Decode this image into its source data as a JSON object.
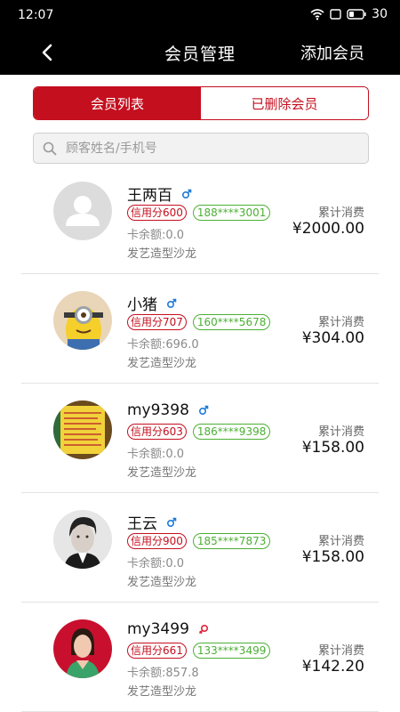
{
  "status": {
    "time": "12:07",
    "battery": "30"
  },
  "nav": {
    "title": "会员管理",
    "add_label": "添加会员"
  },
  "tabs": [
    {
      "label": "会员列表",
      "active": true
    },
    {
      "label": "已删除会员",
      "active": false
    }
  ],
  "search": {
    "placeholder": "顾客姓名/手机号"
  },
  "colors": {
    "accent": "#c40f1f",
    "phone_green": "#4caf33",
    "male_blue": "#1e7bd6",
    "female_red": "#e0223a"
  },
  "members": [
    {
      "name": "王两百",
      "gender": "male",
      "credit": "信用分600",
      "phone": "188****3001",
      "balance": "卡余额:0.0",
      "salon": "发艺造型沙龙",
      "consumption_label": "累计消费",
      "consumption": "¥2000.00",
      "avatar": "default-avatar"
    },
    {
      "name": "小猪",
      "gender": "male",
      "credit": "信用分707",
      "phone": "160****5678",
      "balance": "卡余额:696.0",
      "salon": "发艺造型沙龙",
      "consumption_label": "累计消费",
      "consumption": "¥304.00",
      "avatar": "minion-avatar"
    },
    {
      "name": "my9398",
      "gender": "male",
      "credit": "信用分603",
      "phone": "186****9398",
      "balance": "卡余额:0.0",
      "salon": "发艺造型沙龙",
      "consumption_label": "累计消费",
      "consumption": "¥158.00",
      "avatar": "menu-board-avatar"
    },
    {
      "name": "王云",
      "gender": "male",
      "credit": "信用分900",
      "phone": "185****7873",
      "balance": "卡余额:0.0",
      "salon": "发艺造型沙龙",
      "consumption_label": "累计消费",
      "consumption": "¥158.00",
      "avatar": "man-portrait-avatar"
    },
    {
      "name": "my3499",
      "gender": "female",
      "credit": "信用分661",
      "phone": "133****3499",
      "balance": "卡余额:857.8",
      "salon": "发艺造型沙龙",
      "consumption_label": "累计消费",
      "consumption": "¥142.20",
      "avatar": "woman-portrait-avatar"
    }
  ]
}
